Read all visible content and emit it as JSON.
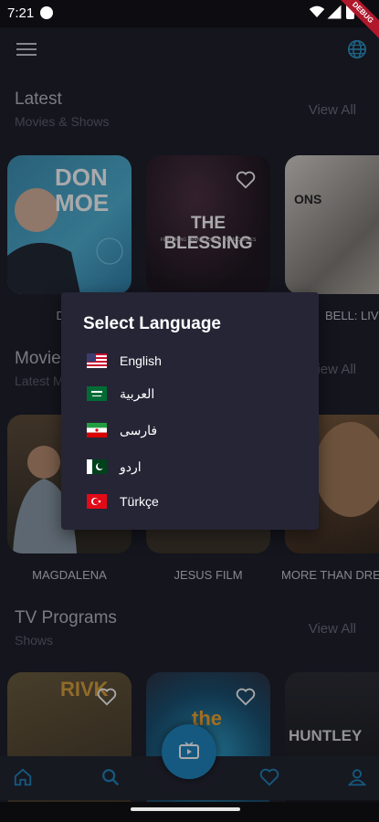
{
  "status_bar": {
    "time": "7:21",
    "debug_banner": "DEBUG"
  },
  "app_bar": {
    "menu_icon": "hamburger-menu-icon",
    "language_icon": "globe-icon"
  },
  "sections": [
    {
      "title": "Latest",
      "subtitle": "Movies & Shows",
      "view_all": "View All",
      "items": [
        {
          "label": "DON",
          "poster_text": "DON MOE"
        },
        {
          "label": "",
          "poster_text": "THE BLESSING",
          "poster_sub": "FEATURING BRAND JOBE & CODE CARNES"
        },
        {
          "label": "BELL: LIVE",
          "poster_text": "ONS"
        }
      ]
    },
    {
      "title": "Movie",
      "subtitle": "Latest M",
      "view_all": "View All",
      "items": [
        {
          "label": "MAGDALENA"
        },
        {
          "label": "JESUS FILM"
        },
        {
          "label": "MORE THAN DRE"
        }
      ]
    },
    {
      "title": "TV Programs",
      "subtitle": "Shows",
      "view_all": "View All",
      "items": [
        {
          "label": "",
          "poster_text": "RIVK"
        },
        {
          "label": "",
          "poster_text": "the"
        },
        {
          "label": "",
          "poster_text": "HUNTLEY"
        }
      ]
    }
  ],
  "dialog": {
    "title": "Select Language",
    "languages": [
      {
        "name": "English",
        "flag": "us-flag-icon"
      },
      {
        "name": "العربية",
        "flag": "saudi-flag-icon"
      },
      {
        "name": "فارسی",
        "flag": "iran-flag-icon"
      },
      {
        "name": "اردو",
        "flag": "pakistan-flag-icon"
      },
      {
        "name": "Türkçe",
        "flag": "turkey-flag-icon"
      }
    ]
  },
  "bottom_nav": {
    "items": [
      "home-icon",
      "search-icon",
      "tv-icon",
      "favorites-heart-icon",
      "profile-icon"
    ],
    "accent": "#1c85bd"
  }
}
